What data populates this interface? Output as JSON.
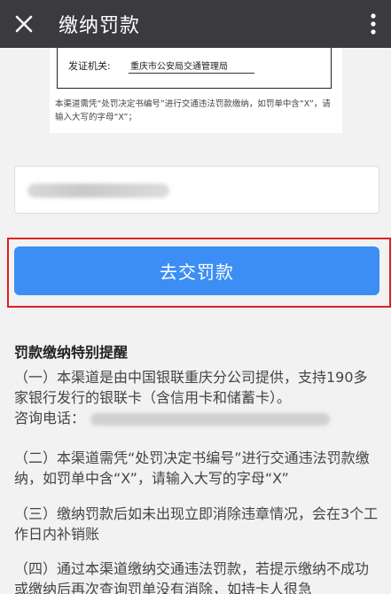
{
  "header": {
    "title": "缴纳罚款",
    "close_icon": "close-icon",
    "more_icon": "more-vertical-icon"
  },
  "sample": {
    "doc_label": "发证机关:",
    "doc_value": "重庆市公安局交通管理局",
    "note": "本渠道需凭“处罚决定书编号”进行交通违法罚款缴纳，如罚单中含“X”，请输入大写的字母“X”；"
  },
  "form": {
    "pay_button_label": "去交罚款"
  },
  "notice": {
    "title": "罚款缴纳特别提醒",
    "p1": "（一）本渠道是由中国银联重庆分公司提供，支持190多家银行发行的银联卡（含信用卡和储蓄卡）。",
    "p1_phone_label": "咨询电话：",
    "p2": "（二）本渠道需凭“处罚决定书编号”进行交通违法罚款缴纳，如罚单中含“X”，请输入大写的字母“X”",
    "p3": "（三）缴纳罚款后如未出现立即消除违章情况，会在3个工作日内补销账",
    "p4": "（四）通过本渠道缴纳交通违法罚款，若提示缴纳不成功或缴纳后再次查询罚单没有消除，如持卡人很急"
  }
}
